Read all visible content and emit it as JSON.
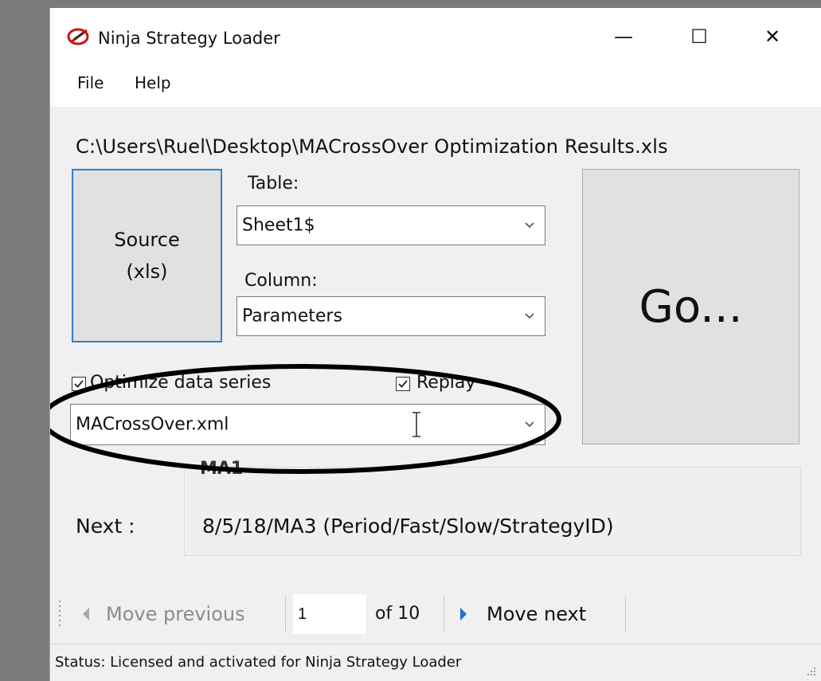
{
  "window": {
    "title": "Ninja Strategy Loader",
    "controls": {
      "minimize": "—",
      "maximize": "☐",
      "close": "✕"
    }
  },
  "menu": {
    "items": [
      "File",
      "Help"
    ]
  },
  "source_path": "C:\\Users\\Ruel\\Desktop\\MACrossOver Optimization Results.xls",
  "source_button": {
    "line1": "Source",
    "line2": "(xls)"
  },
  "table": {
    "label": "Table:",
    "value": "Sheet1$"
  },
  "column": {
    "label": "Column:",
    "value": "Parameters"
  },
  "go_button": {
    "label": "Go..."
  },
  "options": {
    "optimize_label": "Optimize data series",
    "optimize_checked": true,
    "replay_label": "Replay",
    "replay_checked": true
  },
  "template_file": {
    "value": "MACrossOver.xml"
  },
  "info_panel": {
    "header": "MA1",
    "next_label": "Next :",
    "next_value": "8/5/18/MA3 (Period/Fast/Slow/StrategyID)"
  },
  "navigator": {
    "prev_label": "Move previous",
    "current_page": "1",
    "of_label": "of 10",
    "next_label": "Move next"
  },
  "status": {
    "text": "Status:  Licensed and activated for Ninja Strategy Loader"
  },
  "colors": {
    "focus_border": "#2f7fd1",
    "accent_arrow": "#1f6fd0",
    "annotation": "#000000"
  }
}
